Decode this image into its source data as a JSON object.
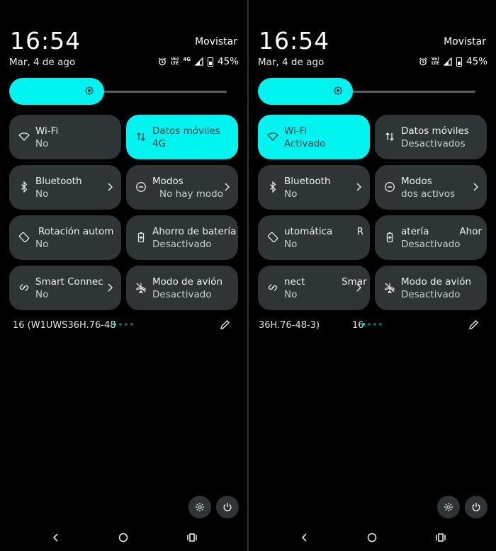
{
  "colors": {
    "accent": "#00f5f1",
    "tile_bg": "#2f3536",
    "background": "#000000"
  },
  "left": {
    "status": {
      "time": "16:54",
      "carrier": "Movistar",
      "date": "Mar, 4 de ago",
      "volte_top": "Vo)",
      "volte_bottom": "LTE",
      "network": "4G",
      "battery": "45%"
    },
    "brightness": {
      "icon": "brightness-icon"
    },
    "tiles": [
      {
        "title": "Wi-Fi",
        "subtitle": "No",
        "icon": "wifi-icon",
        "active": false
      },
      {
        "title": "Datos móviles",
        "subtitle": "4G",
        "icon": "mobile-data-icon",
        "active": true
      },
      {
        "title": "Bluetooth",
        "subtitle": "No",
        "icon": "bluetooth-icon",
        "active": false
      },
      {
        "title": "Modos",
        "subtitle": "No hay modo",
        "icon": "modes-icon",
        "active": false
      },
      {
        "title": "Rotación autom",
        "subtitle": "No",
        "icon": "rotation-icon",
        "active": false
      },
      {
        "title": "Ahorro de batería",
        "subtitle": "Desactivado",
        "icon": "battery-saver-icon",
        "active": false
      },
      {
        "title": "Smart Connec",
        "subtitle": "No",
        "icon": "smart-connect-icon",
        "active": false
      },
      {
        "title": "Modo de avión",
        "subtitle": "Desactivado",
        "icon": "airplane-icon",
        "active": false
      }
    ],
    "build": "16 (W1UWS36H.76-48",
    "page_dots_count": 4
  },
  "right": {
    "status": {
      "time": "16:54",
      "carrier": "Movistar",
      "date": "Mar, 4 de ago",
      "volte_top": "Vo)",
      "volte_bottom": "LTE",
      "network": "",
      "battery": "45%"
    },
    "brightness": {
      "icon": "brightness-icon"
    },
    "tiles": [
      {
        "title": "Wi-Fi",
        "subtitle": "Activado",
        "icon": "wifi-icon",
        "active": true
      },
      {
        "title": "Datos móviles",
        "subtitle": "Desactivados",
        "icon": "mobile-data-icon",
        "active": false
      },
      {
        "title": "Bluetooth",
        "subtitle": "No",
        "icon": "bluetooth-icon",
        "active": false
      },
      {
        "title": "Modos",
        "subtitle": "dos activos",
        "icon": "modes-icon",
        "active": false
      },
      {
        "title": "utomática        R",
        "subtitle": "No",
        "icon": "rotation-icon",
        "active": false
      },
      {
        "title": "atería          Ahor",
        "subtitle": "Desactivado",
        "icon": "battery-saver-icon",
        "active": false
      },
      {
        "title": "nect            Smar",
        "subtitle": "No",
        "icon": "smart-connect-icon",
        "active": false
      },
      {
        "title": "Modo de avión",
        "subtitle": "Desactivado",
        "icon": "airplane-icon",
        "active": false
      }
    ],
    "build": "36H.76-48-3)",
    "build_suffix": "16",
    "page_dots_count": 4
  }
}
